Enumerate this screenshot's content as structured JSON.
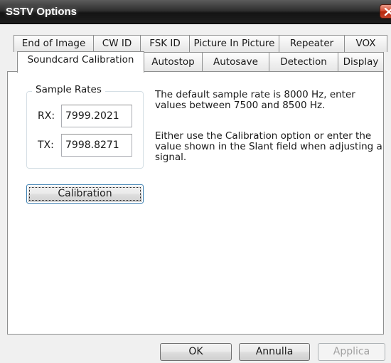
{
  "window": {
    "title": "SSTV Options"
  },
  "tabs": {
    "row1": [
      "End of Image",
      "CW ID",
      "FSK ID",
      "Picture In Picture",
      "Repeater",
      "VOX"
    ],
    "row2": [
      "Soundcard Calibration",
      "Autostop",
      "Autosave",
      "Detection",
      "Display"
    ],
    "active": "Soundcard Calibration"
  },
  "sample_rates": {
    "legend": "Sample Rates",
    "rx_label": "RX:",
    "rx_value": "7999.2021",
    "tx_label": "TX:",
    "tx_value": "7998.8271"
  },
  "info": {
    "line1": "The default sample rate is 8000 Hz, enter values between 7500 and 8500 Hz.",
    "line2": "Either use the Calibration option or enter the value shown in the Slant field when adjusting a signal."
  },
  "buttons": {
    "calibration": "Calibration",
    "ok": "OK",
    "cancel": "Annulla",
    "apply": "Applica"
  }
}
